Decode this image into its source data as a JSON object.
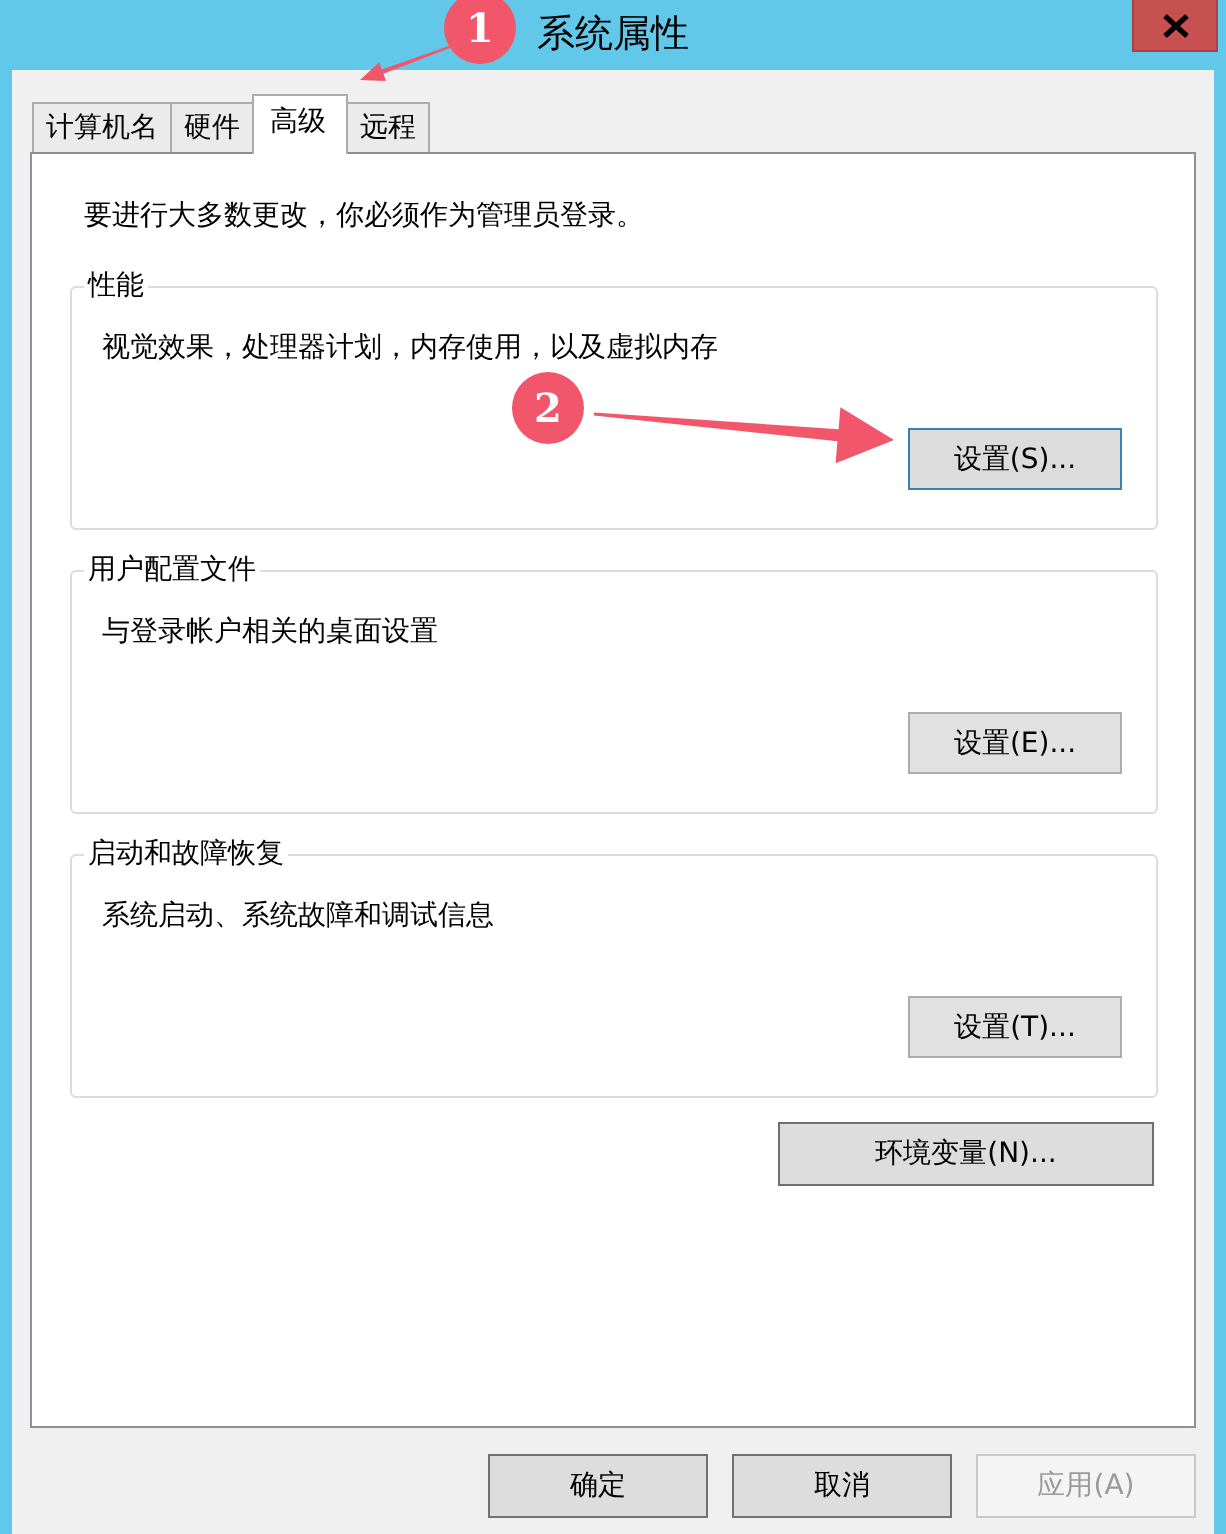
{
  "window": {
    "title": "系统属性"
  },
  "tabs": [
    {
      "label": "计算机名",
      "selected": false
    },
    {
      "label": "硬件",
      "selected": false
    },
    {
      "label": "高级",
      "selected": true
    },
    {
      "label": "远程",
      "selected": false
    }
  ],
  "notice": "要进行大多数更改，你必须作为管理员登录。",
  "groups": [
    {
      "title": "性能",
      "description": "视觉效果，处理器计划，内存使用，以及虚拟内存",
      "button": {
        "label": "设置(S)...",
        "focused": true
      }
    },
    {
      "title": "用户配置文件",
      "description": "与登录帐户相关的桌面设置",
      "button": {
        "label": "设置(E)...",
        "focused": false
      }
    },
    {
      "title": "启动和故障恢复",
      "description": "系统启动、系统故障和调试信息",
      "button": {
        "label": "设置(T)...",
        "focused": false
      }
    }
  ],
  "env_button": {
    "label": "环境变量(N)..."
  },
  "footer_buttons": [
    {
      "label": "确定",
      "disabled": false
    },
    {
      "label": "取消",
      "disabled": false
    },
    {
      "label": "应用(A)",
      "disabled": true
    }
  ],
  "annotations": [
    {
      "label": "1"
    },
    {
      "label": "2"
    }
  ]
}
